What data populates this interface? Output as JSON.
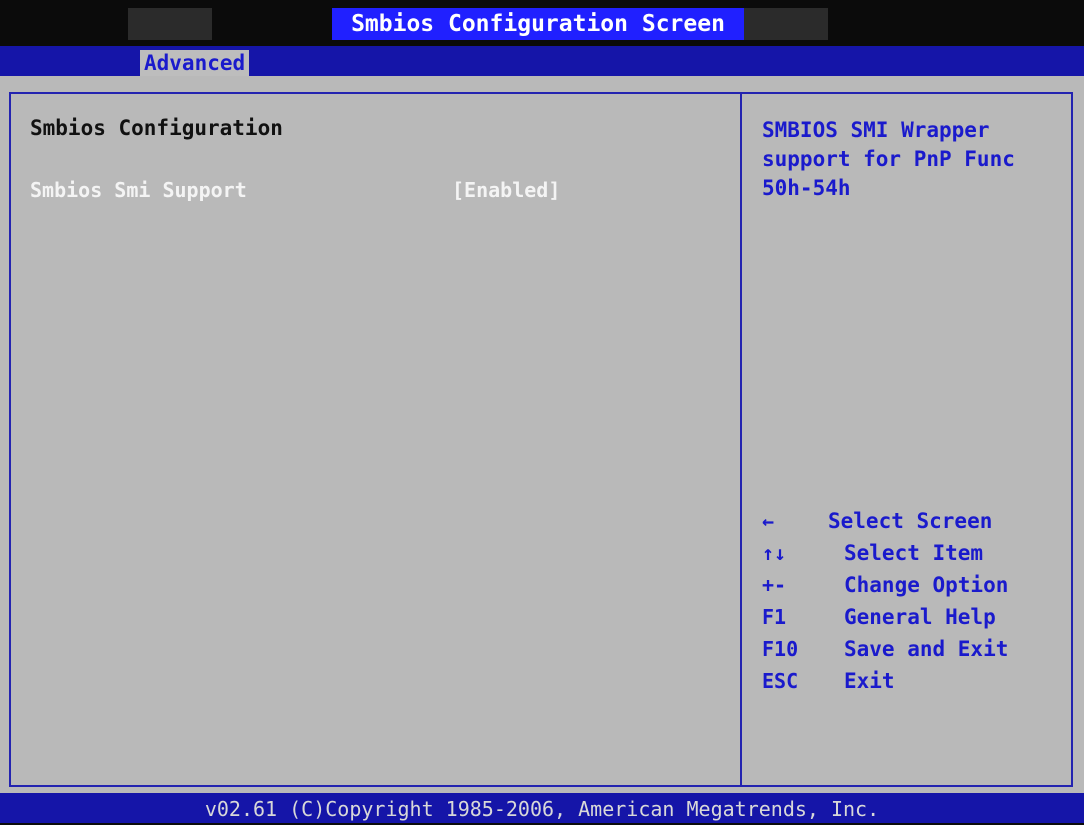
{
  "title": "Smbios Configuration Screen",
  "menu": {
    "active_tab": "Advanced"
  },
  "main": {
    "heading": "Smbios Configuration",
    "setting": {
      "label": "Smbios Smi Support",
      "value": "[Enabled]"
    }
  },
  "help": {
    "text": "SMBIOS SMI Wrapper\nsupport for PnP Func\n50h-54h"
  },
  "keys": [
    {
      "key": "←",
      "action": "Select Screen"
    },
    {
      "key": "↑↓",
      "action": "Select Item"
    },
    {
      "key": "+-",
      "action": "Change Option"
    },
    {
      "key": "F1",
      "action": "General Help"
    },
    {
      "key": "F10",
      "action": "Save and Exit"
    },
    {
      "key": "ESC",
      "action": "Exit"
    }
  ],
  "footer": "v02.61 (C)Copyright 1985-2006, American Megatrends, Inc.",
  "colors": {
    "title_bg": "#2020ff",
    "menubar_bg": "#1515a8",
    "panel_bg": "#b9b9b9",
    "accent_text": "#1a1acc",
    "selected_text": "#f4f4f4"
  }
}
